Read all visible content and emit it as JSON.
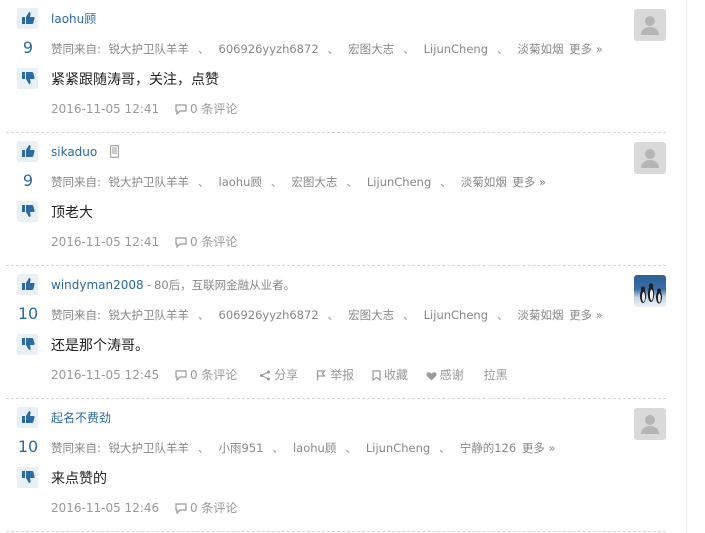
{
  "colors": {
    "link": "#2c6aa5",
    "muted": "#888888",
    "vote_bg": "#e9f0f8"
  },
  "answers": [
    {
      "author": "laohu顾",
      "bio": "",
      "votes": "9",
      "voters_prefix": "赞同来自:",
      "voters": [
        "锐大护卫队羊羊",
        "606926yyzh6872",
        "宏图大志",
        "LijunCheng",
        "淡菊如烟"
      ],
      "more": "更多 »",
      "content": "紧紧跟随涛哥，关注，点赞",
      "time": "2016-11-05 12:41",
      "comments": "0 条评论"
    },
    {
      "author": "sikaduo",
      "bio": "",
      "votes": "9",
      "voters_prefix": "赞同来自:",
      "voters": [
        "锐大护卫队羊羊",
        "laohu顾",
        "宏图大志",
        "LijunCheng",
        "淡菊如烟"
      ],
      "more": "更多 »",
      "content": "顶老大",
      "time": "2016-11-05 12:41",
      "comments": "0 条评论"
    },
    {
      "author": "windyman2008",
      "author_sep": "-",
      "bio": "80后，互联网金融从业者。",
      "votes": "10",
      "voters_prefix": "赞同来自:",
      "voters": [
        "锐大护卫队羊羊",
        "606926yyzh6872",
        "宏图大志",
        "LijunCheng",
        "淡菊如烟"
      ],
      "more": "更多 »",
      "content": "还是那个涛哥。",
      "time": "2016-11-05 12:45",
      "comments": "0 条评论",
      "actions": {
        "share": "分享",
        "report": "举报",
        "favorite": "收藏",
        "thanks": "感谢",
        "block": "拉黑"
      }
    },
    {
      "author": "起名不费劲",
      "bio": "",
      "votes": "10",
      "voters_prefix": "赞同来自:",
      "voters": [
        "锐大护卫队羊羊",
        "小雨951",
        "laohu顾",
        "LijunCheng",
        "宁静的126"
      ],
      "more": "更多 »",
      "content": "来点赞的",
      "time": "2016-11-05 12:46",
      "comments": "0 条评论"
    }
  ]
}
